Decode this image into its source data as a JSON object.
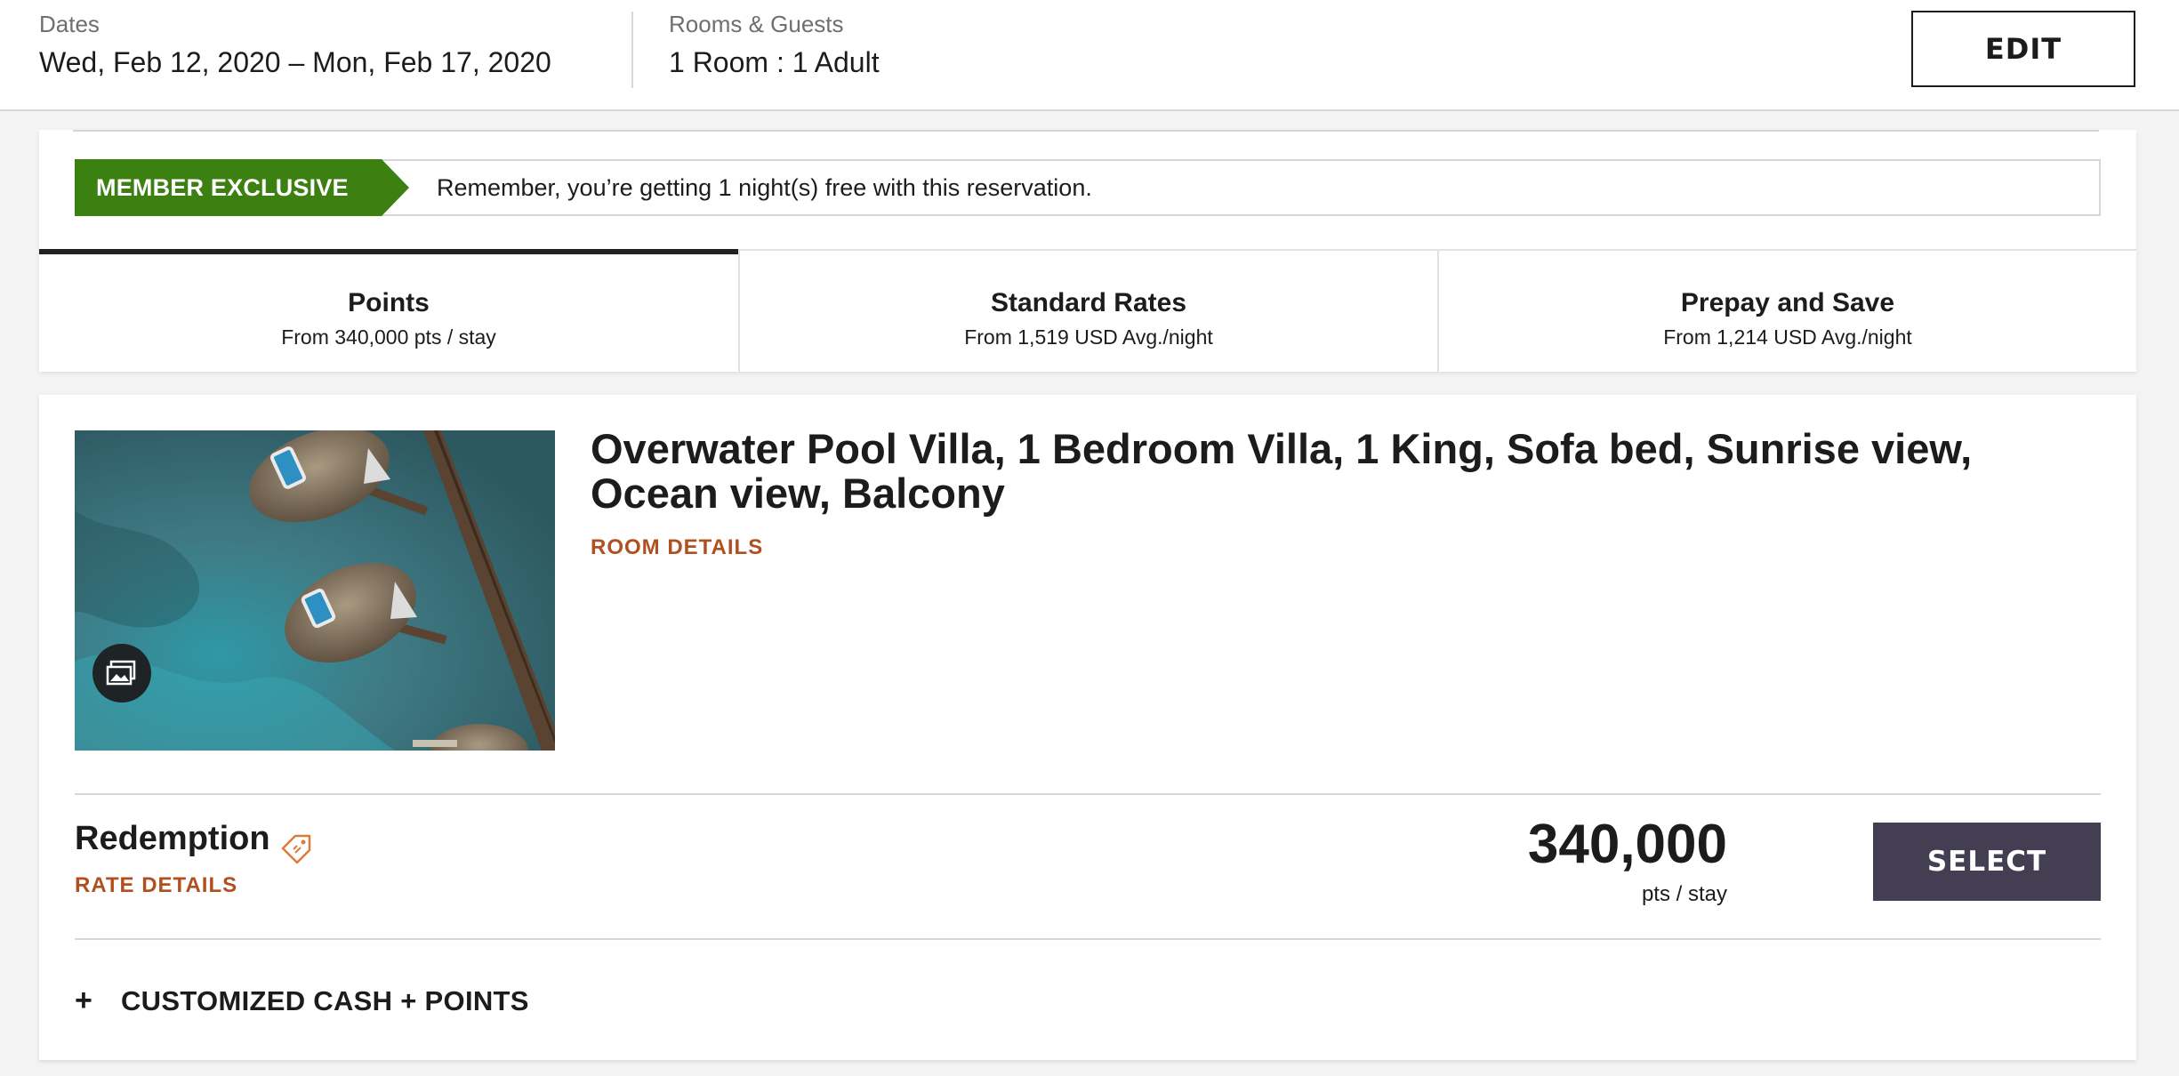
{
  "search_summary": {
    "dates_label": "Dates",
    "dates_value": "Wed, Feb 12, 2020 – Mon, Feb 17, 2020",
    "rooms_label": "Rooms & Guests",
    "rooms_value": "1 Room : 1 Adult",
    "edit_label": "EDIT"
  },
  "member_banner": {
    "tag": "MEMBER EXCLUSIVE",
    "message": "Remember, you’re getting 1 night(s) free with this reservation.",
    "tag_color": "#3d8012"
  },
  "tabs": [
    {
      "title": "Points",
      "subtitle": "From 340,000 pts / stay",
      "active": true
    },
    {
      "title": "Standard Rates",
      "subtitle": "From 1,519 USD Avg./night",
      "active": false
    },
    {
      "title": "Prepay and Save",
      "subtitle": "From 1,214 USD Avg./night",
      "active": false
    }
  ],
  "room": {
    "title": "Overwater Pool Villa, 1 Bedroom Villa, 1 King, Sofa bed, Sunrise view, Ocean view, Balcony",
    "details_link": "ROOM DETAILS",
    "gallery_icon": "gallery-icon",
    "rate": {
      "name": "Redemption",
      "tag_icon": "price-tag-icon",
      "details_link": "RATE DETAILS",
      "price": "340,000",
      "price_unit": "pts / stay",
      "select_label": "SELECT"
    },
    "cash_points": {
      "expand_symbol": "+",
      "label": "CUSTOMIZED CASH + POINTS"
    }
  },
  "colors": {
    "accent_link": "#b0501f",
    "select_button": "#433e52",
    "member_green": "#3d8012"
  }
}
